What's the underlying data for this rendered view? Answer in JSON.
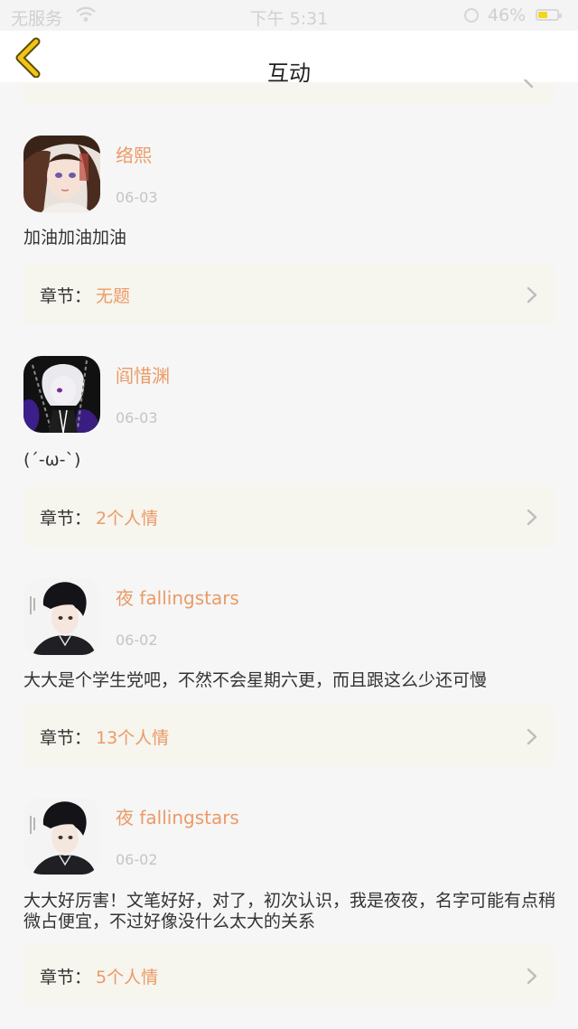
{
  "status_bar": {
    "carrier": "无服务",
    "time": "下午 5:31",
    "battery_percent": "46%",
    "battery_level": 0.46,
    "battery_color": "#f7d51b"
  },
  "nav": {
    "title": "互动",
    "back_icon": "chevron-left-icon",
    "back_color": "#f0c419"
  },
  "comments": [
    {
      "user": "络熙",
      "date": "06-03",
      "content": "加油加油加油",
      "chapter_label": "章节：",
      "chapter_title": "无题"
    },
    {
      "user": "阎惜渊",
      "date": "06-03",
      "content": "(´-ω-`)",
      "chapter_label": "章节：",
      "chapter_title": "2个人情"
    },
    {
      "user": "夜 fallingstars",
      "date": "06-02",
      "content": "大大是个学生党吧，不然不会星期六更，而且跟这么少还可慢",
      "chapter_label": "章节：",
      "chapter_title": "13个人情"
    },
    {
      "user": "夜 fallingstars",
      "date": "06-02",
      "content": "大大好厉害！文笔好好，对了，初次认识，我是夜夜，名字可能有点稍微占便宜，不过好像没什么太大的关系",
      "chapter_label": "章节：",
      "chapter_title": "5个人情"
    }
  ],
  "colors": {
    "accent": "#eb9a66",
    "card_bg": "#f6f5ee",
    "page_bg": "#f6f6f6"
  }
}
